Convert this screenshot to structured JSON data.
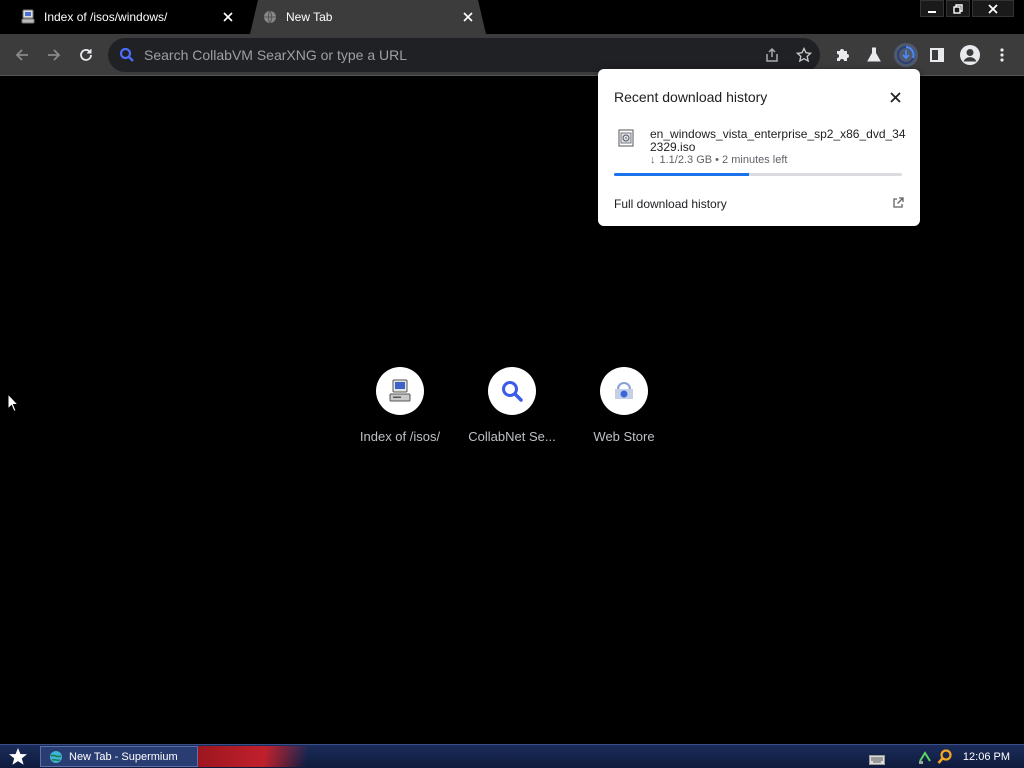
{
  "tabs": [
    {
      "title": "Index of /isos/windows/",
      "favicon": "server-icon",
      "active": true
    },
    {
      "title": "New Tab",
      "favicon": "globe-icon",
      "active": false
    }
  ],
  "toolbar": {
    "omnibox_placeholder": "Search CollabVM SearXNG or type a URL"
  },
  "downloads": {
    "title": "Recent download history",
    "item": {
      "filename": "en_windows_vista_enterprise_sp2_x86_dvd_342329.iso",
      "status": "1.1/2.3 GB • 2 minutes left",
      "progress": 0.47
    },
    "footer_link": "Full download history"
  },
  "shortcuts": [
    {
      "label": "Index of /isos/",
      "icon": "server-icon"
    },
    {
      "label": "CollabNet Se...",
      "icon": "search-icon"
    },
    {
      "label": "Web Store",
      "icon": "webstore-icon"
    }
  ],
  "taskbar": {
    "task_label": "New Tab - Supermium",
    "clock": "12:06 PM"
  },
  "colors": {
    "accent": "#1a73e8",
    "toolbar": "#3c3c3c",
    "page_bg": "#000000",
    "taskbar": "#1b2c5a"
  }
}
